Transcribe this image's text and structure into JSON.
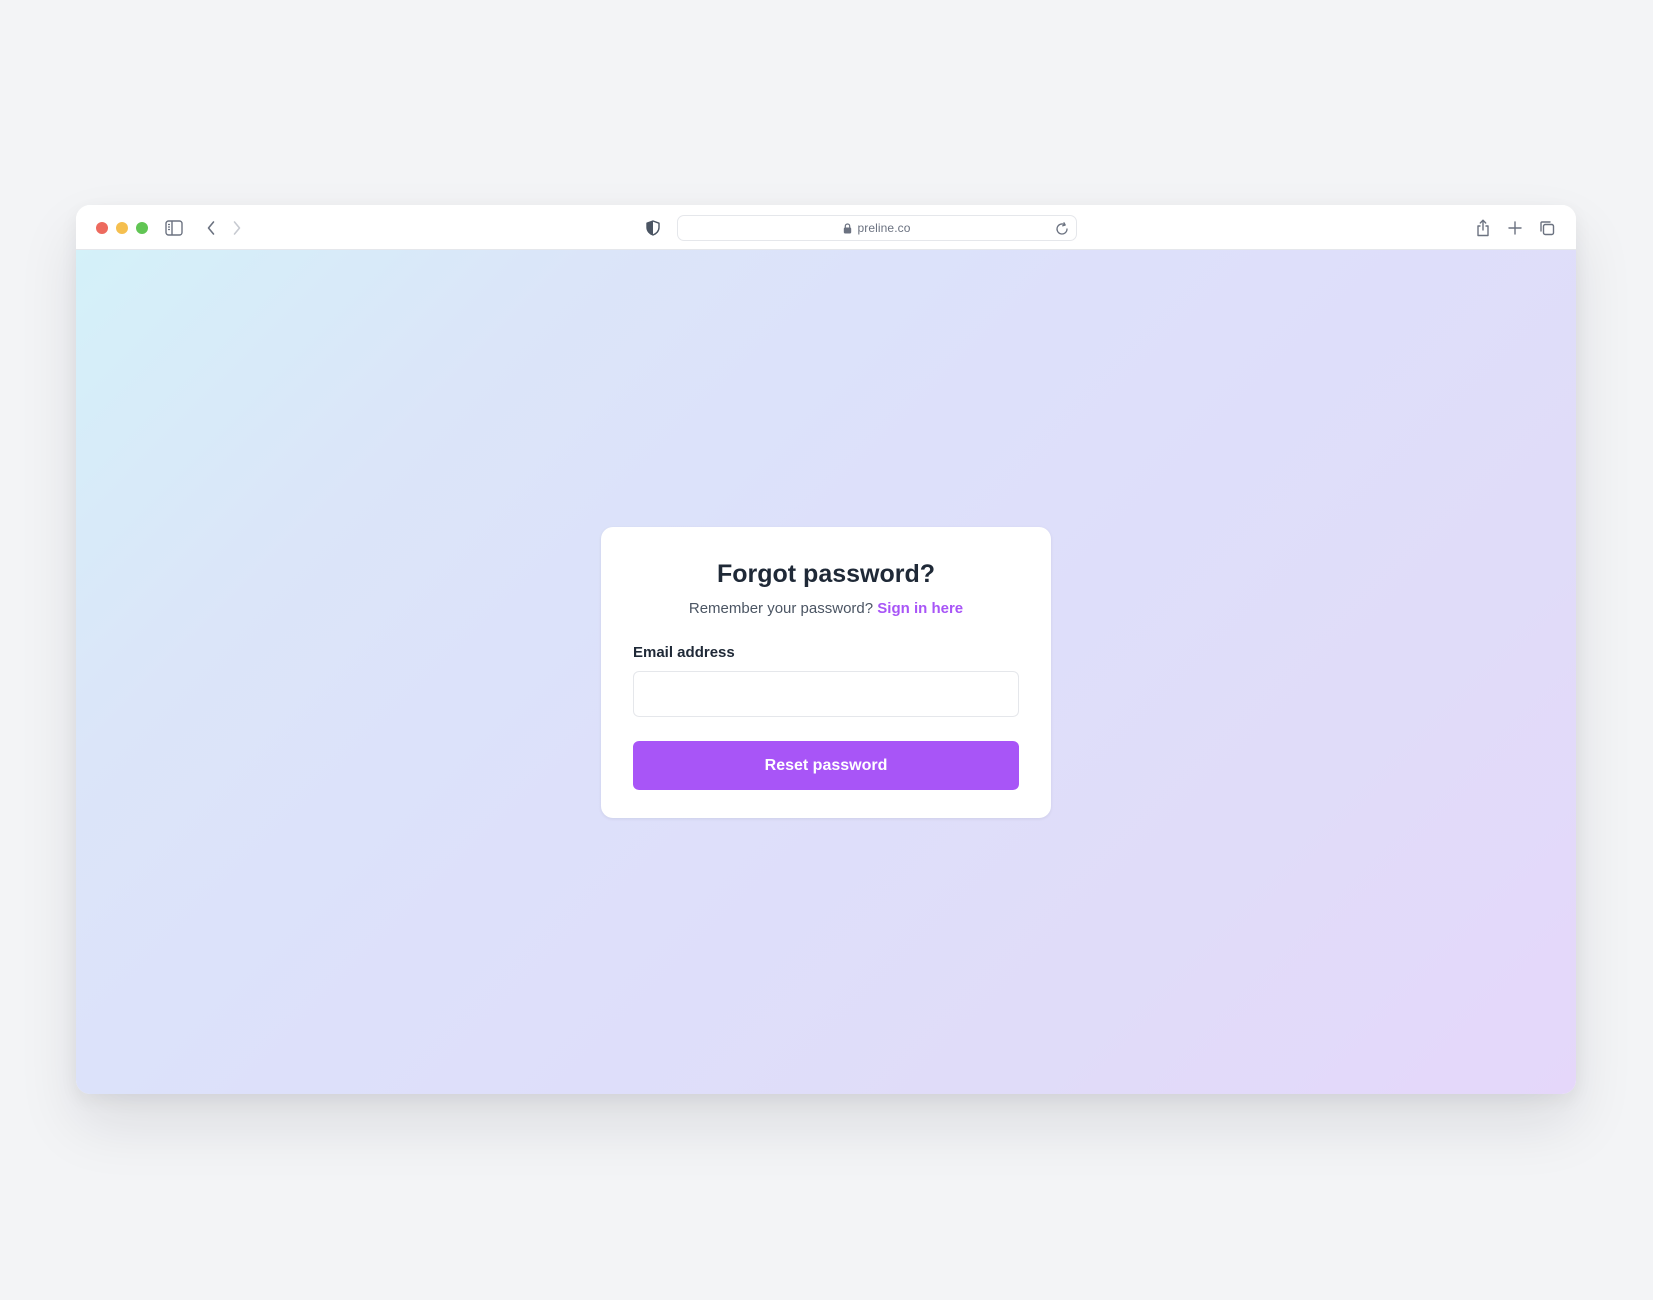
{
  "browser": {
    "url": "preline.co",
    "icons": {
      "sidebar": "sidebar-icon",
      "back": "chevron-left-icon",
      "forward": "chevron-right-icon",
      "privacy": "shield-icon",
      "lock": "lock-icon",
      "reload": "reload-icon",
      "share": "share-icon",
      "new_tab": "plus-icon",
      "tabs": "tabs-icon"
    },
    "colors": {
      "close": "#ed6a5e",
      "minimize": "#f5bf4f",
      "zoom": "#61c554"
    }
  },
  "form": {
    "title": "Forgot password?",
    "subtitle_prefix": "Remember your password?",
    "signin_link": "Sign in here",
    "email_label": "Email address",
    "email_value": "",
    "email_placeholder": "",
    "submit_label": "Reset password",
    "accent_color": "#a855f7"
  }
}
